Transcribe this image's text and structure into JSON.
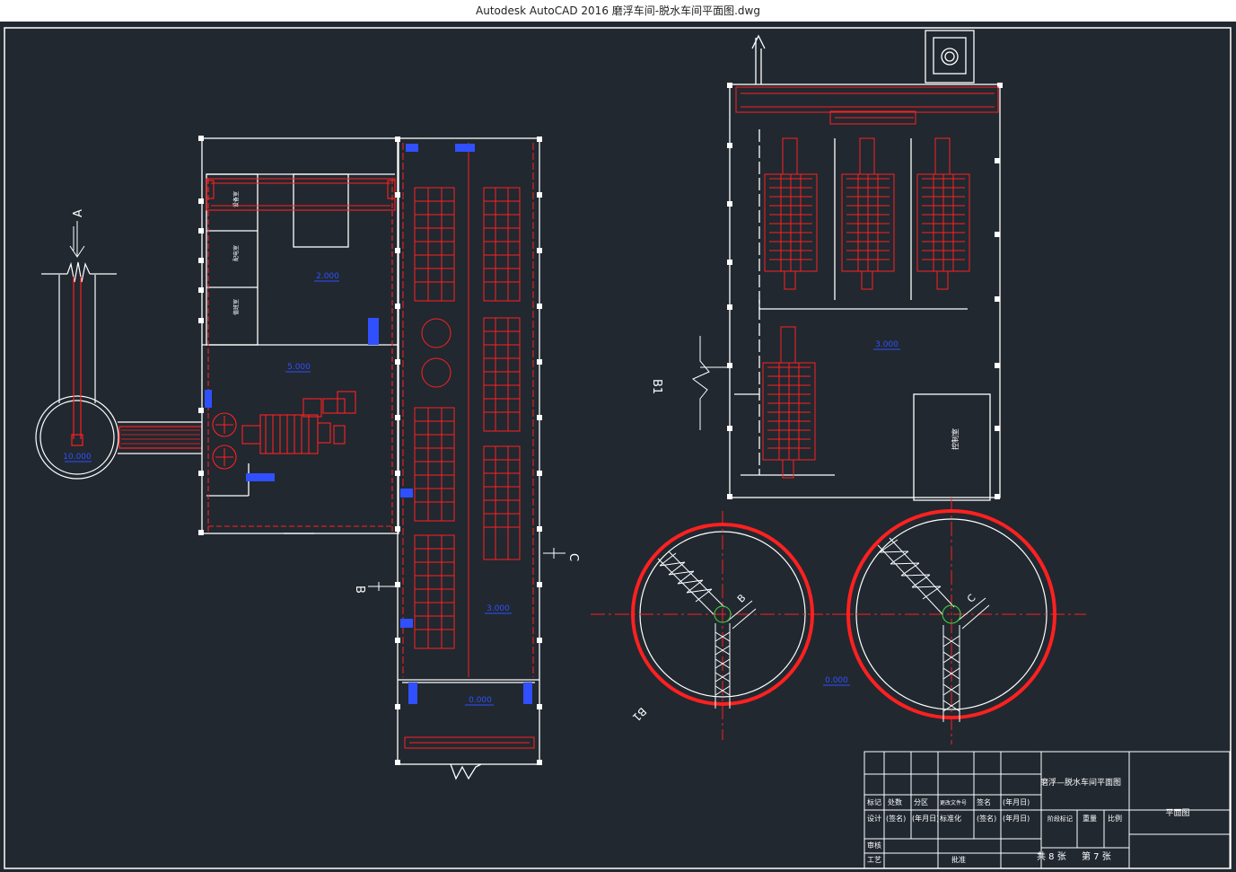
{
  "window": {
    "title": "Autodesk AutoCAD 2016     磨浮车间-脱水车间平面图.dwg"
  },
  "drawing": {
    "section_marks": {
      "a": "A",
      "b": "B",
      "c": "C",
      "b1": "B1",
      "b1_thickener": "B1",
      "b_thickener": "B",
      "c_thickener": "C"
    },
    "elevations": {
      "sump": "10.000",
      "upper_room": "2.000",
      "mill_room": "5.000",
      "float_mid": "3.000",
      "float_bottom": "0.000",
      "dewater": "3.000",
      "thickener": "0.000"
    },
    "room_labels": {
      "control_room": "控制室",
      "equip_1": "设备室",
      "equip_2": "配电室",
      "equip_3": "值班室"
    }
  },
  "title_block": {
    "drawing_name": "磨浮—脱水车间平面图",
    "drawing_type": "平面图",
    "row1": [
      "标记",
      "处数",
      "分区",
      "更改文件号",
      "签名",
      "(年月日)"
    ],
    "row2": [
      "设计",
      "(签名)",
      "(年月日)",
      "标准化",
      "(签名)",
      "(年月日)"
    ],
    "stage": "阶段标记",
    "weight": "重量",
    "scale": "比例",
    "audit": "审核",
    "process": "工艺",
    "approve": "批准",
    "sheets_total": "共 8 张",
    "sheet_no": "第 7 张"
  }
}
